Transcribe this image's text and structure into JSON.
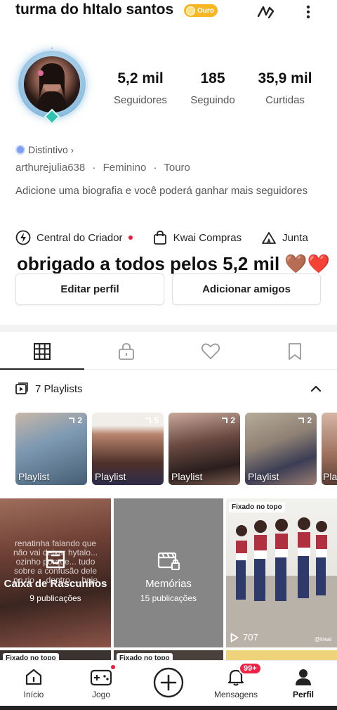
{
  "header": {
    "title": "turma do hItalo santos",
    "level_badge": "Ouro",
    "icons": [
      "scribble-icon",
      "more-vertical-icon"
    ]
  },
  "profile": {
    "stats": [
      {
        "value": "5,2 mil",
        "label": "Seguidores"
      },
      {
        "value": "185",
        "label": "Seguindo"
      },
      {
        "value": "35,9 mil",
        "label": "Curtidas"
      }
    ],
    "badge_link": "Distintivo",
    "username": "arthurejulia638",
    "gender": "Feminino",
    "sign": "Touro",
    "separator": "·",
    "bio": "Adicione uma biografia e você poderá ganhar mais seguidores",
    "shortcuts": [
      {
        "label": "Central do Criador",
        "icon": "lightning-icon",
        "dot": true
      },
      {
        "label": "Kwai Compras",
        "icon": "shopping-bag-icon",
        "dot": false
      },
      {
        "label": "Junta",
        "icon": "tent-icon",
        "dot": false
      }
    ],
    "banner": "obrigado a todos pelos 5,2 mil 🤎❤️",
    "buttons": {
      "edit": "Editar perfil",
      "add_friends": "Adicionar amigos"
    }
  },
  "tabs": [
    "grid-icon",
    "lock-icon",
    "heart-icon",
    "bookmark-icon"
  ],
  "playlists": {
    "header": "7 Playlists",
    "items": [
      {
        "label": "Playlist",
        "count": "2",
        "color": "#8aa4bd"
      },
      {
        "label": "Playlist",
        "count": "5",
        "color": "#9a6b5c"
      },
      {
        "label": "Playlist",
        "count": "2",
        "color": "#5a423c"
      },
      {
        "label": "Playlist",
        "count": "2",
        "color": "#b1a79e"
      },
      {
        "label": "Pla",
        "count": "",
        "color": "#c7a08e"
      }
    ]
  },
  "grid": {
    "drafts": {
      "title": "Caixa de Rascunhos",
      "subtitle": "9 publicações",
      "overlay": "renatinha falando que não vai deixar hytalo... ozinho porque... tudo sobre a confusão dele no rio ... dentro ... hoje"
    },
    "memories": {
      "title": "Memórias",
      "subtitle": "15 publicações"
    },
    "pinned": {
      "tag": "Fixado no topo",
      "views": "707",
      "watermark": "@kwai"
    },
    "row2_tags": [
      "Fixado no topo",
      "Fixado no topo"
    ]
  },
  "bottom_nav": [
    {
      "label": "Início",
      "icon": "home-icon"
    },
    {
      "label": "Jogo",
      "icon": "gamepad-icon",
      "dot": true
    },
    {
      "label": "",
      "icon": "plus-circle-icon"
    },
    {
      "label": "Mensagens",
      "icon": "bell-icon",
      "badge": "99+"
    },
    {
      "label": "Perfil",
      "icon": "person-icon",
      "active": true
    }
  ]
}
